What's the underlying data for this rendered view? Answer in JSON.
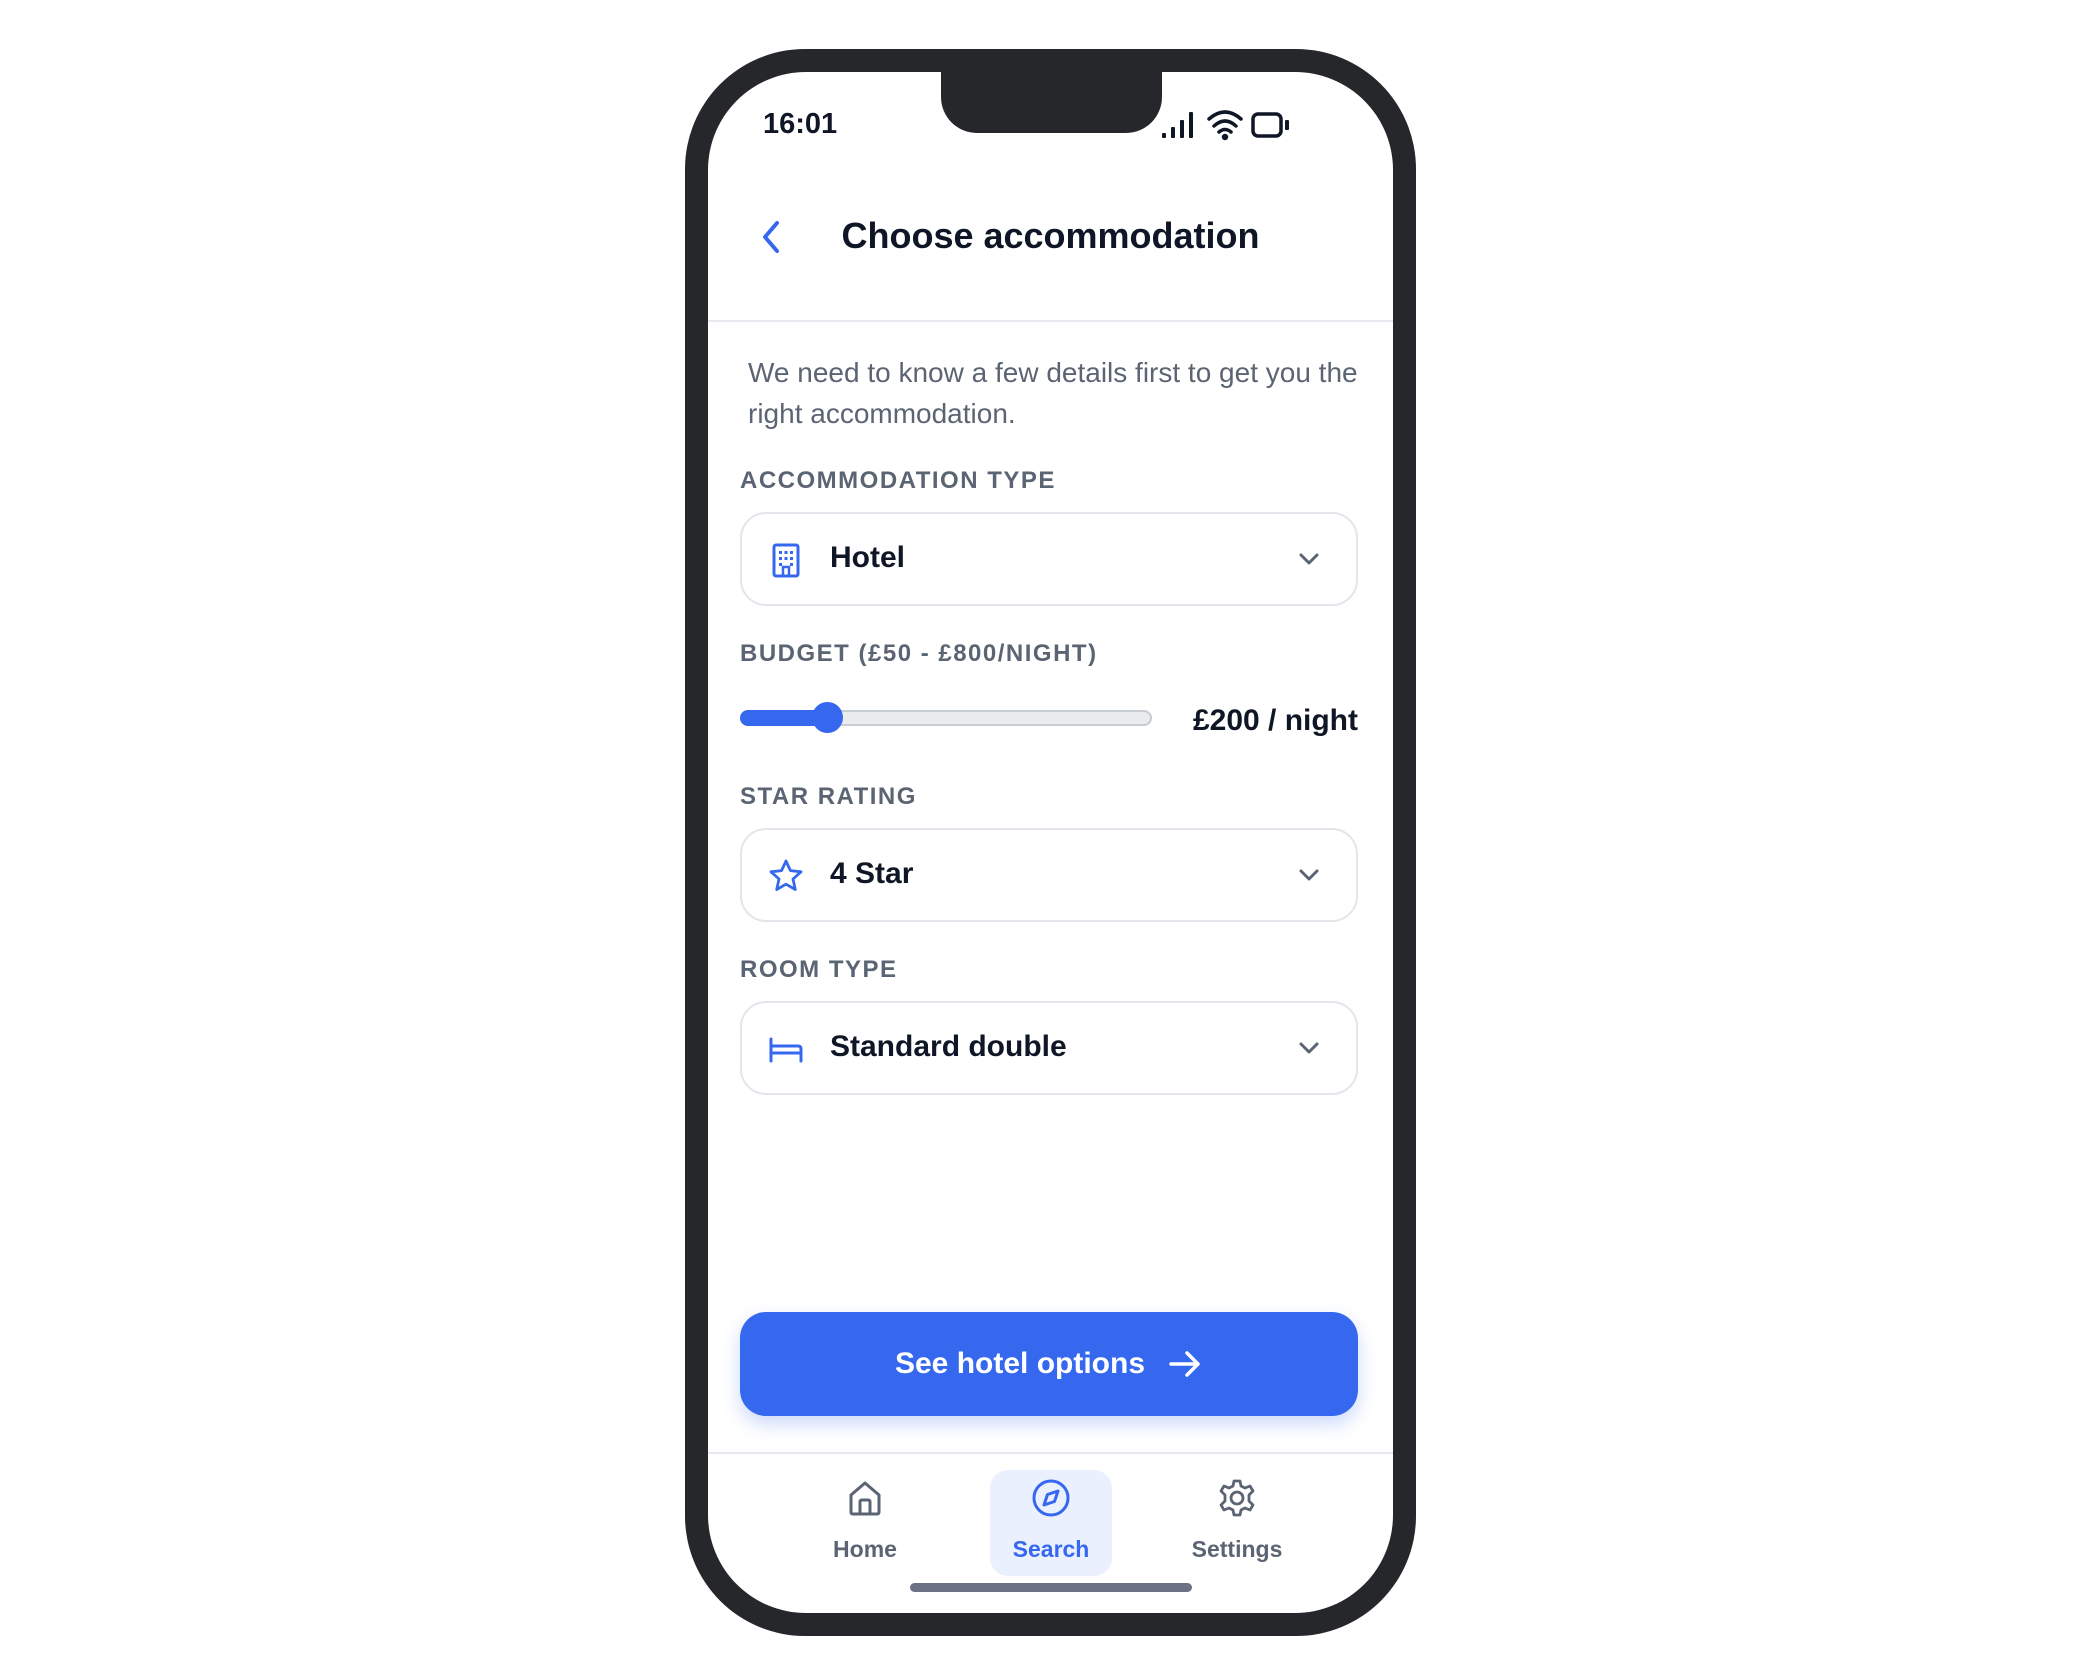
{
  "status_bar": {
    "time": "16:01"
  },
  "header": {
    "title": "Choose accommodation"
  },
  "intro_text": "We need to know a few details first to get you the right accommodation.",
  "accommodation_type": {
    "label": "ACCOMMODATION TYPE",
    "value": "Hotel",
    "icon": "building-icon"
  },
  "budget": {
    "label": "BUDGET (£50 - £800/NIGHT)",
    "value_text": "£200 / night",
    "min": 50,
    "max": 800,
    "value": 200
  },
  "star_rating": {
    "label": "STAR RATING",
    "value": "4 Star",
    "icon": "star-icon"
  },
  "room_type": {
    "label": "ROOM TYPE",
    "value": "Standard double",
    "icon": "bed-icon"
  },
  "cta": {
    "label": "See hotel options"
  },
  "tabs": [
    {
      "label": "Home",
      "icon": "home-icon",
      "active": false
    },
    {
      "label": "Search",
      "icon": "compass-icon",
      "active": true
    },
    {
      "label": "Settings",
      "icon": "gear-icon",
      "active": false
    }
  ],
  "colors": {
    "accent": "#3568ef",
    "text": "#0f1626",
    "muted": "#5b6473"
  }
}
